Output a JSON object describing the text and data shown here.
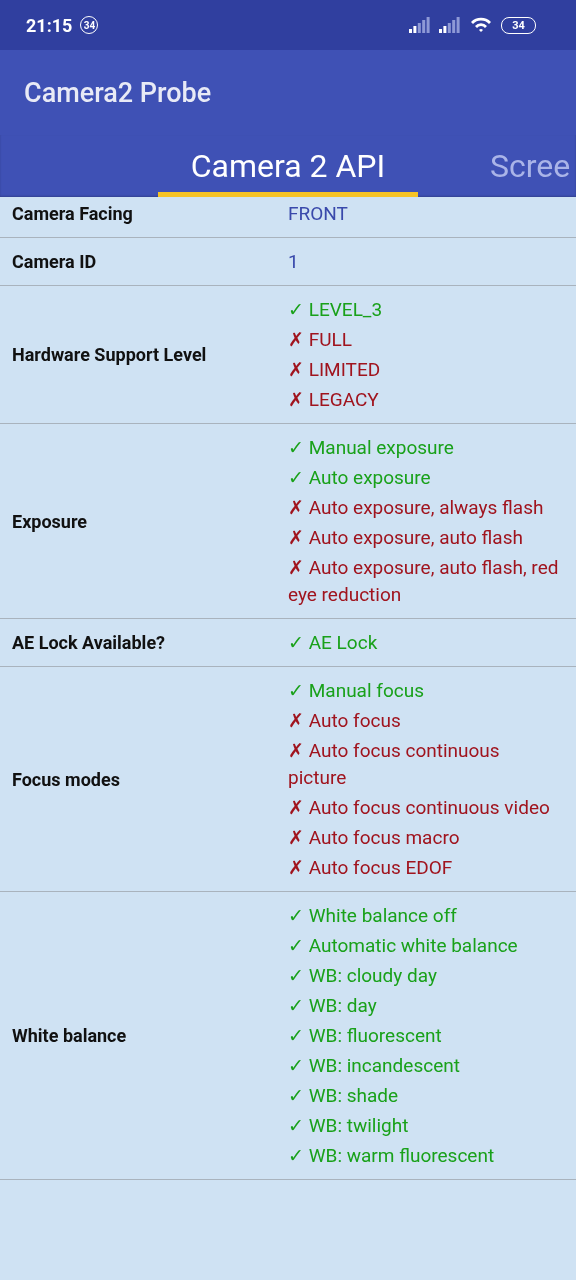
{
  "status_bar": {
    "time": "21:15",
    "notification_badge": "34",
    "battery": "34"
  },
  "app_bar": {
    "title": "Camera2 Probe"
  },
  "tabs": [
    {
      "label": "Camera 2 API",
      "selected": true
    },
    {
      "label": "Scree",
      "selected": false
    }
  ],
  "rows": [
    {
      "label": "Camera Facing",
      "values": [
        {
          "kind": "plain",
          "text": "FRONT"
        }
      ]
    },
    {
      "label": "Camera ID",
      "values": [
        {
          "kind": "plain",
          "text": "1"
        }
      ]
    },
    {
      "label": "Hardware Support Level",
      "values": [
        {
          "kind": "check",
          "mark": "✓",
          "text": "LEVEL_3",
          "supported": true
        },
        {
          "kind": "check",
          "mark": "✗",
          "text": "FULL",
          "supported": false
        },
        {
          "kind": "check",
          "mark": "✗",
          "text": "LIMITED",
          "supported": false
        },
        {
          "kind": "check",
          "mark": "✗",
          "text": "LEGACY",
          "supported": false
        }
      ]
    },
    {
      "label": "Exposure",
      "values": [
        {
          "kind": "check",
          "mark": "✓",
          "text": "Manual exposure",
          "supported": true
        },
        {
          "kind": "check",
          "mark": "✓",
          "text": "Auto exposure",
          "supported": true
        },
        {
          "kind": "check",
          "mark": "✗",
          "text": "Auto exposure, always flash",
          "supported": false
        },
        {
          "kind": "check",
          "mark": "✗",
          "text": "Auto exposure, auto flash",
          "supported": false
        },
        {
          "kind": "check",
          "mark": "✗",
          "text": "Auto exposure, auto flash, red eye reduction",
          "supported": false
        }
      ]
    },
    {
      "label": "AE Lock Available?",
      "values": [
        {
          "kind": "check",
          "mark": "✓",
          "text": "AE Lock",
          "supported": true
        }
      ]
    },
    {
      "label": "Focus modes",
      "values": [
        {
          "kind": "check",
          "mark": "✓",
          "text": "Manual focus",
          "supported": true
        },
        {
          "kind": "check",
          "mark": "✗",
          "text": "Auto focus",
          "supported": false
        },
        {
          "kind": "check",
          "mark": "✗",
          "text": "Auto focus continuous picture",
          "supported": false
        },
        {
          "kind": "check",
          "mark": "✗",
          "text": "Auto focus continuous video",
          "supported": false
        },
        {
          "kind": "check",
          "mark": "✗",
          "text": "Auto focus macro",
          "supported": false
        },
        {
          "kind": "check",
          "mark": "✗",
          "text": "Auto focus EDOF",
          "supported": false
        }
      ]
    },
    {
      "label": "White balance",
      "values": [
        {
          "kind": "check",
          "mark": "✓",
          "text": "White balance off",
          "supported": true
        },
        {
          "kind": "check",
          "mark": "✓",
          "text": "Automatic white balance",
          "supported": true
        },
        {
          "kind": "check",
          "mark": "✓",
          "text": "WB: cloudy day",
          "supported": true
        },
        {
          "kind": "check",
          "mark": "✓",
          "text": "WB: day",
          "supported": true
        },
        {
          "kind": "check",
          "mark": "✓",
          "text": "WB: fluorescent",
          "supported": true
        },
        {
          "kind": "check",
          "mark": "✓",
          "text": "WB: incandescent",
          "supported": true
        },
        {
          "kind": "check",
          "mark": "✓",
          "text": "WB: shade",
          "supported": true
        },
        {
          "kind": "check",
          "mark": "✓",
          "text": "WB: twilight",
          "supported": true
        },
        {
          "kind": "check",
          "mark": "✓",
          "text": "WB: warm fluorescent",
          "supported": true
        }
      ]
    }
  ]
}
